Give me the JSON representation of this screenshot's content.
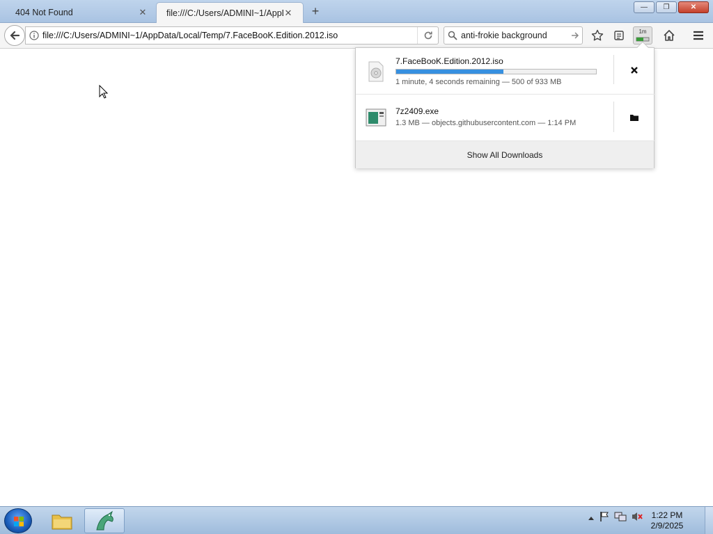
{
  "tabs": [
    {
      "title": "404 Not Found"
    },
    {
      "title": "file:///C:/Users/ADMINI~1/AppD"
    }
  ],
  "window_buttons": {
    "minimize": "—",
    "maximize": "❐",
    "close": "✕"
  },
  "navbar": {
    "url": "file:///C:/Users/ADMINI~1/AppData/Local/Temp/7.FaceBooK.Edition.2012.iso",
    "search_text": "anti-frokie background",
    "download_badge": "1m"
  },
  "downloads": [
    {
      "name": "7.FaceBooK.Edition.2012.iso",
      "status": "1 minute, 4 seconds remaining — 500 of 933 MB",
      "progress": 0.536,
      "action": "cancel",
      "icon": "disc-image-icon"
    },
    {
      "name": "7z2409.exe",
      "status": "1.3 MB — objects.githubusercontent.com — 1:14 PM",
      "action": "open-folder",
      "icon": "exe-file-icon"
    }
  ],
  "show_all": "Show All Downloads",
  "taskbar": {
    "time": "1:22 PM",
    "date": "2/9/2025",
    "apps": [
      "file-explorer-icon",
      "browser-icon"
    ]
  },
  "colors": {
    "accent": "#3790e0",
    "tabbar": "#b6cde8"
  }
}
